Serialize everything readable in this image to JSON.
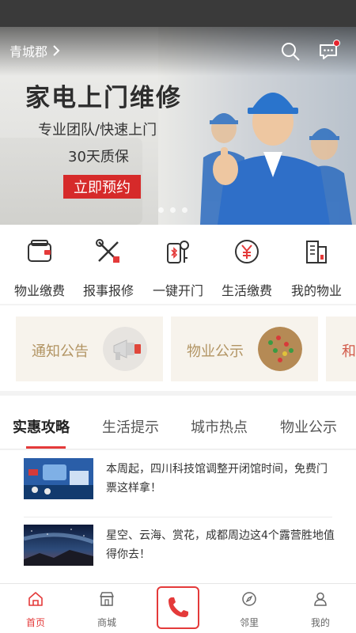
{
  "header": {
    "city": "青城郡",
    "search_icon": "search-icon",
    "message_icon": "message-icon",
    "has_unread": true
  },
  "banner": {
    "title": "家电上门维修",
    "subtitle1": "专业团队/快速上门",
    "subtitle2": "30天质保",
    "cta": "立即预约",
    "slides_count": 3,
    "active_slide": 0
  },
  "quick_actions": [
    {
      "label": "物业缴费",
      "icon": "wallet-icon"
    },
    {
      "label": "报事报修",
      "icon": "tools-icon"
    },
    {
      "label": "一键开门",
      "icon": "key-icon"
    },
    {
      "label": "生活缴费",
      "icon": "yen-coin-icon"
    },
    {
      "label": "我的物业",
      "icon": "building-icon"
    }
  ],
  "cards": [
    {
      "label": "通知公告",
      "icon": "megaphone-icon"
    },
    {
      "label": "物业公示",
      "icon": "pushpin-board-icon"
    },
    {
      "label": "和"
    }
  ],
  "tabs": [
    {
      "label": "实惠攻略",
      "active": true
    },
    {
      "label": "生活提示",
      "active": false
    },
    {
      "label": "城市热点",
      "active": false
    },
    {
      "label": "物业公示",
      "active": false
    }
  ],
  "news": [
    {
      "text": "本周起，四川科技馆调整开闭馆时间，免费门票这样拿！",
      "thumb": "science-museum-photo"
    },
    {
      "text": "星空、云海、赏花，成都周边这4个露营胜地值得你去！",
      "thumb": "starry-sky-photo"
    }
  ],
  "bottom_nav": [
    {
      "label": "首页",
      "icon": "home-icon",
      "active": true
    },
    {
      "label": "商城",
      "icon": "shop-icon",
      "active": false
    },
    {
      "label": "",
      "icon": "phone-icon",
      "active": false
    },
    {
      "label": "邻里",
      "icon": "compass-icon",
      "active": false
    },
    {
      "label": "我的",
      "icon": "user-icon",
      "active": false
    }
  ],
  "colors": {
    "accent": "#e43a3a",
    "card_text": "#b29463",
    "card_bg": "#f7f3ec"
  }
}
